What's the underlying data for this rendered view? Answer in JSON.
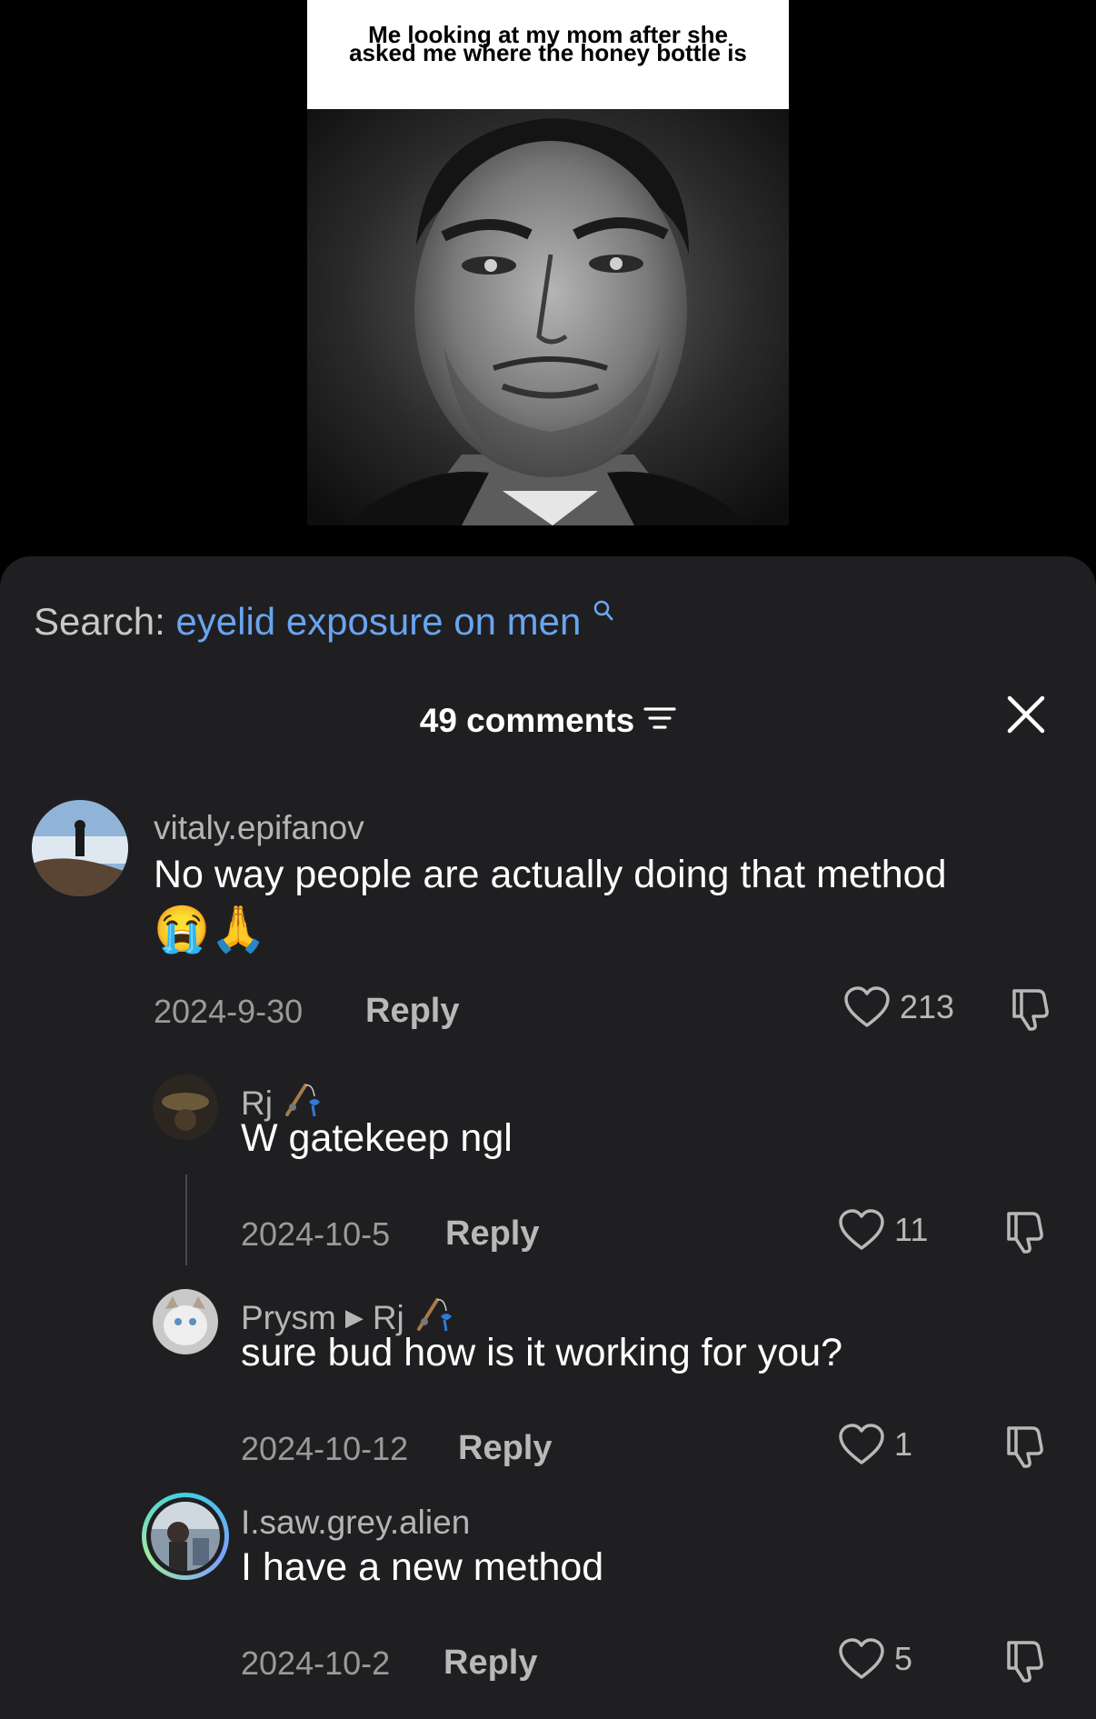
{
  "meme": {
    "caption_line1": "Me looking at my mom after she",
    "caption_line2": "asked me where the honey bottle is"
  },
  "search": {
    "prefix": "Search:",
    "query": "eyelid exposure on men"
  },
  "header": {
    "count_label": "49 comments"
  },
  "colors": {
    "sheet_bg": "#1f1f21",
    "search_link": "#6aa4f0",
    "muted_text": "#9a9a9a"
  },
  "comments": [
    {
      "username": "vitaly.epifanov",
      "text": "No way people are actually doing that method",
      "emojis": "😭🙏",
      "date": "2024-9-30",
      "reply": "Reply",
      "likes": "213"
    },
    {
      "username": "Rj",
      "badge_icon": "fishing-rod-icon",
      "text": "W gatekeep ngl",
      "date": "2024-10-5",
      "reply": "Reply",
      "likes": "11"
    },
    {
      "username": "Prysm",
      "reply_to": "Rj",
      "badge_icon": "fishing-rod-icon",
      "text": "sure bud how is it working for you?",
      "date": "2024-10-12",
      "reply": "Reply",
      "likes": "1"
    },
    {
      "username": "I.saw.grey.alien",
      "text": "I have a new method",
      "date": "2024-10-2",
      "reply": "Reply",
      "likes": "5"
    }
  ]
}
